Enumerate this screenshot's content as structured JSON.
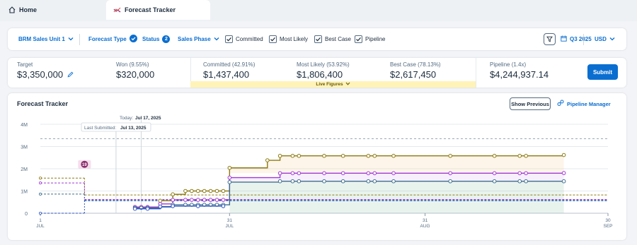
{
  "tabs": [
    {
      "label": "Home"
    },
    {
      "label": "Forecast Tracker"
    }
  ],
  "filters": {
    "sales_unit": "BRM Sales Unit 1",
    "forecast_type": "Forecast Type",
    "status": "Status",
    "status_count": "2",
    "sales_phase": "Sales Phase",
    "checkboxes": [
      {
        "label": "Committed",
        "checked": true
      },
      {
        "label": "Most Likely",
        "checked": true
      },
      {
        "label": "Best Case",
        "checked": true
      },
      {
        "label": "Pipeline",
        "checked": true
      }
    ],
    "period": "Q3 2025",
    "currency": "USD"
  },
  "summary": {
    "target_label": "Target",
    "target_value": "$3,350,000",
    "won_label": "Won  (9.55%)",
    "won_value": "$320,000",
    "committed_label": "Committed  (42.91%)",
    "committed_value": "$1,437,400",
    "most_likely_label": "Most Likely  (53.92%)",
    "most_likely_value": "$1,806,400",
    "best_case_label": "Best Case  (78.13%)",
    "best_case_value": "$2,617,450",
    "pipeline_label": "Pipeline  (1.4x)",
    "pipeline_value": "$4,244,937.14",
    "live_figures": "Live Figures",
    "submit_label": "Submit"
  },
  "tracker": {
    "title": "Forecast Tracker",
    "show_previous": "Show Previous",
    "pipeline_manager": "Pipeline Manager",
    "today_label": "Today:",
    "today_date": "Jul 17, 2025",
    "last_submitted_label": "Last Submitted:",
    "last_submitted_date": "Jul 13, 2025",
    "marker_label": "19"
  },
  "colors": {
    "accent": "#0a6ed1",
    "best_case": "#8d7a11",
    "most_likely": "#a137d6",
    "committed": "#3d6f8f",
    "won": "#2f55c4",
    "target": "#9aa8b5",
    "marker": "#8b2a6b"
  },
  "chart_data": {
    "type": "line",
    "y_ticks": [
      "0",
      "1M",
      "2M",
      "3M",
      "4M"
    ],
    "ylim": [
      0,
      4000000
    ],
    "x_ticks": [
      {
        "day": "1",
        "month": "JUL"
      },
      {
        "day": "31",
        "month": "JUL"
      },
      {
        "day": "31",
        "month": "AUG"
      },
      {
        "day": "30",
        "month": "SEP"
      }
    ],
    "target": 3350000,
    "series": [
      {
        "name": "Best Case",
        "color": "#8d7a11",
        "previous": 1580000,
        "previous_end_day": 8,
        "submitted": 820000,
        "points": [
          [
            16,
            280000
          ],
          [
            17,
            280000
          ],
          [
            18,
            280000
          ],
          [
            20,
            560000
          ],
          [
            22,
            850000
          ],
          [
            24,
            1000000
          ],
          [
            25,
            1000000
          ],
          [
            26,
            1000000
          ],
          [
            27,
            1000000
          ],
          [
            28,
            1000000
          ],
          [
            29,
            1000000
          ],
          [
            30,
            1000000
          ],
          [
            31,
            2040000
          ],
          [
            37,
            2380000
          ],
          [
            39,
            2580000
          ],
          [
            41,
            2580000
          ],
          [
            42,
            2580000
          ],
          [
            46,
            2580000
          ],
          [
            49,
            2580000
          ],
          [
            53,
            2580000
          ],
          [
            54,
            2580000
          ],
          [
            57,
            2580000
          ],
          [
            66,
            2580000
          ],
          [
            73,
            2580000
          ],
          [
            77,
            2580000
          ],
          [
            78,
            2580000
          ],
          [
            84,
            2617450
          ]
        ]
      },
      {
        "name": "Most Likely",
        "color": "#a137d6",
        "previous": 1360000,
        "previous_end_day": 8,
        "submitted": 620000,
        "points": [
          [
            16,
            280000
          ],
          [
            17,
            280000
          ],
          [
            18,
            280000
          ],
          [
            20,
            420000
          ],
          [
            22,
            600000
          ],
          [
            24,
            600000
          ],
          [
            25,
            600000
          ],
          [
            26,
            600000
          ],
          [
            27,
            600000
          ],
          [
            28,
            600000
          ],
          [
            29,
            600000
          ],
          [
            30,
            600000
          ],
          [
            31,
            1600000
          ],
          [
            39,
            1800000
          ],
          [
            41,
            1800000
          ],
          [
            42,
            1800000
          ],
          [
            46,
            1800000
          ],
          [
            49,
            1800000
          ],
          [
            53,
            1800000
          ],
          [
            54,
            1800000
          ],
          [
            57,
            1800000
          ],
          [
            66,
            1800000
          ],
          [
            73,
            1800000
          ],
          [
            77,
            1800000
          ],
          [
            78,
            1800000
          ],
          [
            84,
            1806400
          ]
        ]
      },
      {
        "name": "Committed",
        "color": "#3d6f8f",
        "previous": 860000,
        "previous_end_day": 8,
        "submitted": 560000,
        "points": [
          [
            16,
            240000
          ],
          [
            17,
            240000
          ],
          [
            18,
            240000
          ],
          [
            20,
            280000
          ],
          [
            22,
            380000
          ],
          [
            24,
            380000
          ],
          [
            25,
            380000
          ],
          [
            26,
            380000
          ],
          [
            27,
            380000
          ],
          [
            28,
            380000
          ],
          [
            29,
            380000
          ],
          [
            30,
            380000
          ],
          [
            31,
            1400000
          ],
          [
            39,
            1437400
          ],
          [
            41,
            1437400
          ],
          [
            42,
            1437400
          ],
          [
            46,
            1437400
          ],
          [
            49,
            1437400
          ],
          [
            53,
            1437400
          ],
          [
            54,
            1437400
          ],
          [
            57,
            1437400
          ],
          [
            66,
            1437400
          ],
          [
            73,
            1437400
          ],
          [
            77,
            1437400
          ],
          [
            78,
            1437400
          ],
          [
            84,
            1437400
          ]
        ]
      },
      {
        "name": "Won",
        "color": "#2f55c4",
        "previous": 0,
        "previous_end_day": 8,
        "submitted": 580000,
        "points": [
          [
            16,
            200000
          ],
          [
            18,
            200000
          ],
          [
            20,
            300000
          ],
          [
            22,
            320000
          ],
          [
            26,
            320000
          ],
          [
            30,
            320000
          ]
        ]
      }
    ]
  }
}
